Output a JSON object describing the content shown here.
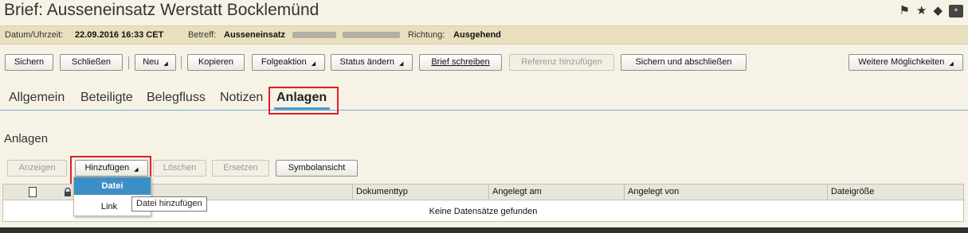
{
  "header": {
    "title": "Brief: Ausseneinsatz Werstatt Bocklemünd",
    "icons": [
      "flag-icon",
      "star-icon",
      "tag-icon",
      "add-note-icon"
    ],
    "icon_glyphs": {
      "flag": "⚑",
      "star": "★",
      "tag": "🏷",
      "add": "+"
    }
  },
  "info": {
    "datum_label": "Datum/Uhrzeit:",
    "datum_value": "22.09.2016 16:33 CET",
    "betreff_label": "Betreff:",
    "betreff_value": "Ausseneinsatz",
    "richtung_label": "Richtung:",
    "richtung_value": "Ausgehend"
  },
  "toolbar": {
    "sichern": "Sichern",
    "schliessen": "Schließen",
    "neu": "Neu",
    "kopieren": "Kopieren",
    "folgeaktion": "Folgeaktion",
    "status_aendern": "Status ändern",
    "brief_schreiben": "Brief schreiben",
    "referenz_hinzufuegen": "Referenz hinzufügen",
    "sichern_abschliessen": "Sichern und abschließen",
    "weitere": "Weitere Möglichkeiten"
  },
  "tabs": [
    {
      "label": "Allgemein"
    },
    {
      "label": "Beteiligte"
    },
    {
      "label": "Belegfluss"
    },
    {
      "label": "Notizen"
    },
    {
      "label": "Anlagen",
      "active": true
    }
  ],
  "section": {
    "title": "Anlagen",
    "buttons": {
      "anzeigen": "Anzeigen",
      "hinzufuegen": "Hinzufügen",
      "loeschen": "Löschen",
      "ersetzen": "Ersetzen",
      "symbolansicht": "Symbolansicht"
    }
  },
  "table": {
    "columns": [
      "Dokumenttyp",
      "Angelegt am",
      "Angelegt von",
      "Dateigröße"
    ],
    "empty_text": "Keine Datensätze gefunden"
  },
  "dropdown": {
    "items": [
      "Datei",
      "Link"
    ],
    "tooltip": "Datei hinzufügen"
  },
  "colors": {
    "accent": "#4a9dd6",
    "highlight": "#e02020",
    "selected": "#3c8fc4"
  }
}
